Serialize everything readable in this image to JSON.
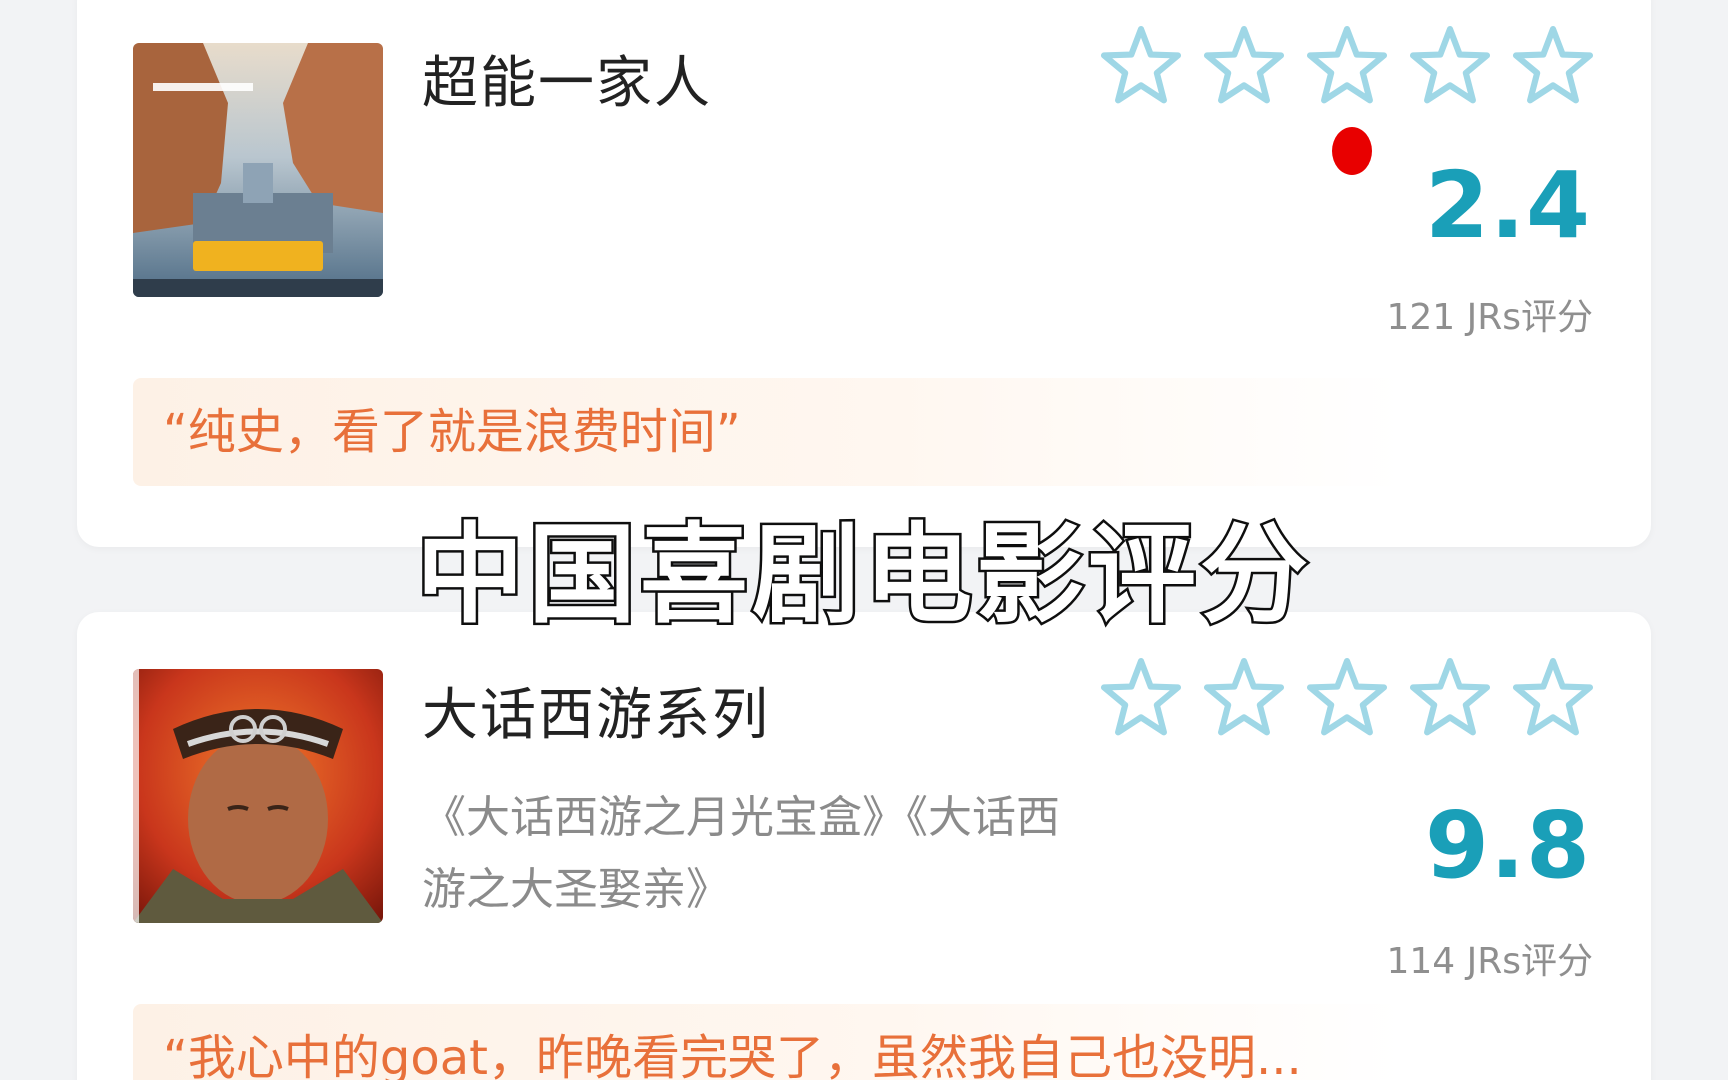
{
  "overlay": {
    "title": "中国喜剧电影评分"
  },
  "colors": {
    "score": "#1a9fb8",
    "star_outline": "#9fd7e6",
    "quote_text": "#e8703a",
    "quote_bg": "#fdf1e6",
    "red_dot": "#e80000"
  },
  "movies": [
    {
      "title": "超能一家人",
      "subtitle": "",
      "score": "2.4",
      "count": "121 JRs评分",
      "quote": "“纯史，看了就是浪费时间”",
      "stars_filled": 0,
      "poster": {
        "icon": "movie-poster-icon"
      }
    },
    {
      "title": "大话西游系列",
      "subtitle": "《大话西游之月光宝盒》《大话西游之大圣娶亲》",
      "score": "9.8",
      "count": "114 JRs评分",
      "quote": "“我心中的goat，昨晚看完哭了，虽然我自己也没明...",
      "stars_filled": 0,
      "poster": {
        "icon": "movie-poster-icon"
      }
    }
  ]
}
